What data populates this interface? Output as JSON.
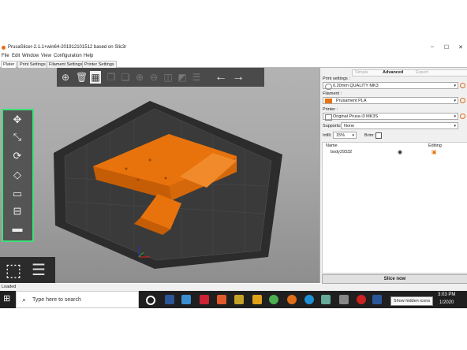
{
  "window": {
    "title": "PrusaSlicer-2.1.1+win64-201912101512 based on Slic3r",
    "minimize": "–",
    "maximize": "☐",
    "close": "✕"
  },
  "menu": [
    "File",
    "Edit",
    "Window",
    "View",
    "Configuration",
    "Help"
  ],
  "tabs": [
    "Plater",
    "Print Settings",
    "Filament Settings",
    "Printer Settings"
  ],
  "mode": {
    "simple": "Simple",
    "advanced": "Advanced",
    "expert": "Expert"
  },
  "panel": {
    "print_label": "Print settings :",
    "print_value": "0.20mm QUALITY MK3",
    "filament_label": "Filament :",
    "filament_value": "Prusament PLA",
    "filament_color": "#e8730c",
    "printer_label": "Printer :",
    "printer_value": "Original Prusa i3 MK3S",
    "supports_label": "Supports:",
    "supports_value": "None",
    "infill_label": "Infill:",
    "infill_value": "15%",
    "brim_label": "Brim:",
    "col_name": "Name",
    "col_editing": "Editing",
    "object_name": "body29332",
    "slice_label": "Slice now"
  },
  "status": {
    "text": "Loaded"
  },
  "taskbar": {
    "search_placeholder": "Type here to search",
    "time": "3:03 PM",
    "date": "1/2020",
    "tooltip": "Show hidden icons"
  },
  "colors": {
    "accent": "#e8730c",
    "highlight": "#3fe07a",
    "model": "#e8730c"
  }
}
